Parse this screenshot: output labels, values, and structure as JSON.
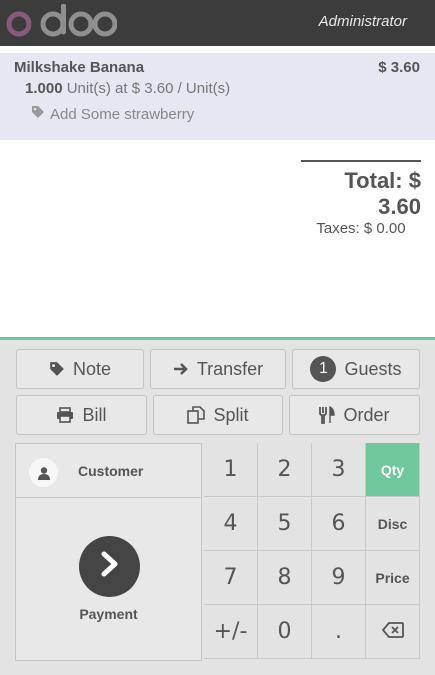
{
  "header": {
    "logo_text": "odoo",
    "user_name": "Administrator"
  },
  "order": {
    "line": {
      "product_name": "Milkshake Banana",
      "price": "$ 3.60",
      "quantity": "1.000",
      "unit_info": "Unit(s) at $ 3.60 / Unit(s)",
      "note": "Add Some strawberry"
    },
    "total_label": "Total:",
    "total_value": "$ 3.60",
    "taxes_label": "Taxes:",
    "taxes_value": "$ 0.00"
  },
  "control_buttons": {
    "note": "Note",
    "transfer": "Transfer",
    "guests_count": "1",
    "guests": "Guests",
    "bill": "Bill",
    "split": "Split",
    "order": "Order"
  },
  "actionpad": {
    "customer": "Customer",
    "payment": "Payment"
  },
  "numpad": {
    "k1": "1",
    "k2": "2",
    "k3": "3",
    "k4": "4",
    "k5": "5",
    "k6": "6",
    "k7": "7",
    "k8": "8",
    "k9": "9",
    "plusminus": "+/-",
    "k0": "0",
    "dot": ".",
    "qty": "Qty",
    "disc": "Disc",
    "price": "Price",
    "active_mode": "Qty"
  },
  "colors": {
    "accent": "#6ec89b",
    "topbar": "#3c3c3c",
    "logo": "#875a7b",
    "logo_gray": "#8f8f8f"
  }
}
